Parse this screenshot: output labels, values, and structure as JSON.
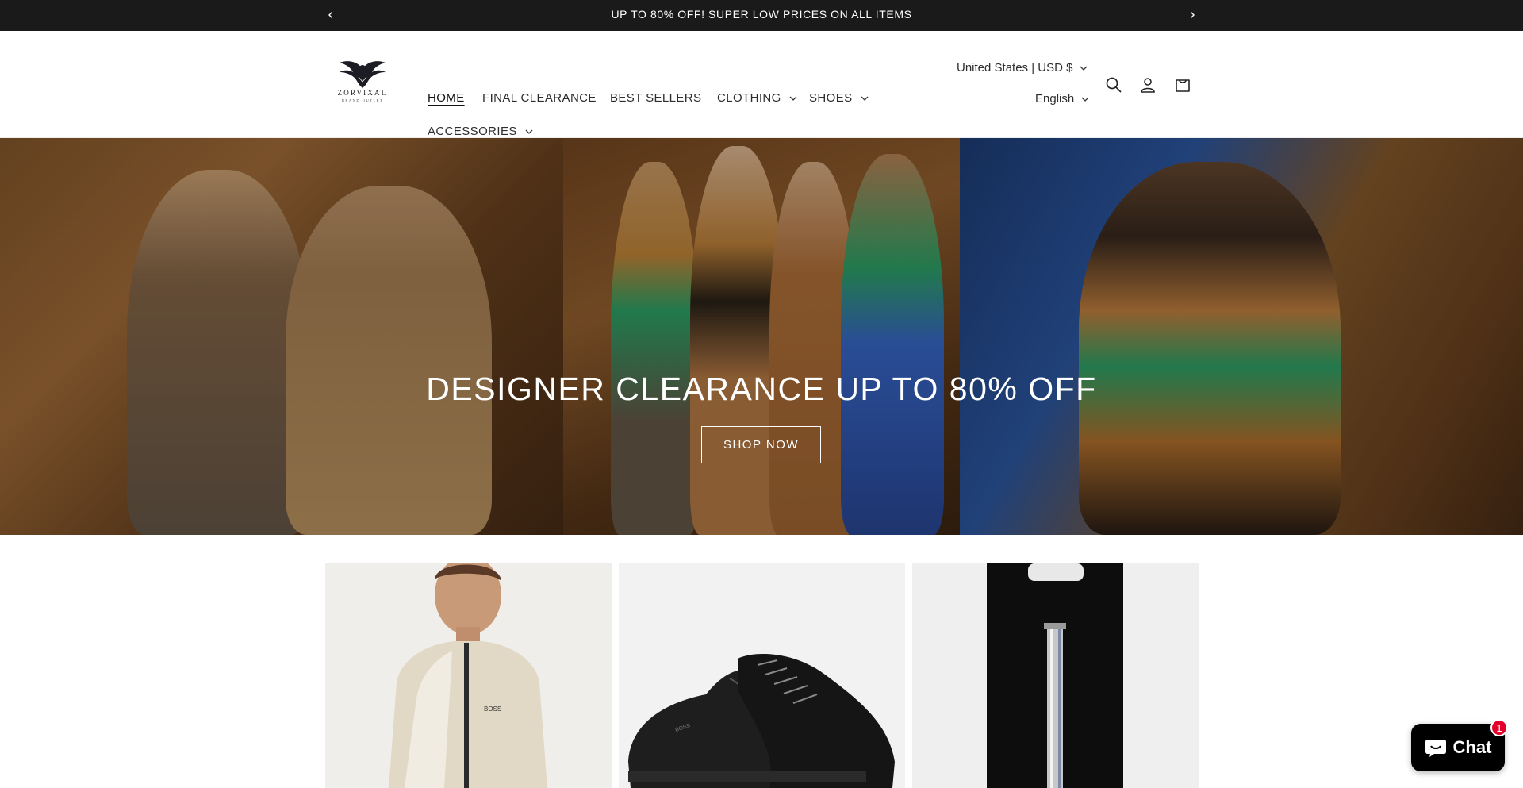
{
  "announcement": {
    "message": "UP TO 80% OFF! SUPER LOW PRICES ON ALL ITEMS"
  },
  "header": {
    "logo": {
      "brand": "ZORVIXAL",
      "sub": "BRAND OUTLET"
    },
    "nav": [
      {
        "label": "HOME",
        "active": true,
        "dropdown": false
      },
      {
        "label": "FINAL CLEARANCE",
        "active": false,
        "dropdown": false
      },
      {
        "label": "BEST SELLERS",
        "active": false,
        "dropdown": false
      },
      {
        "label": "CLOTHING",
        "active": false,
        "dropdown": true
      },
      {
        "label": "SHOES",
        "active": false,
        "dropdown": true
      },
      {
        "label": "ACCESSORIES",
        "active": false,
        "dropdown": true
      }
    ],
    "country_currency": "United States | USD $",
    "language": "English",
    "icons": [
      "search-icon",
      "account-icon",
      "cart-icon"
    ]
  },
  "hero": {
    "title": "DESIGNER CLEARANCE UP TO 80% OFF",
    "cta": "SHOP NOW"
  },
  "products": [
    {
      "image": "beige-zip-jacket-man",
      "brand_mark": "BOSS"
    },
    {
      "image": "black-leather-sneaker",
      "brand_mark": "BOSS"
    },
    {
      "image": "pen-refill-package",
      "brand_mark": ""
    }
  ],
  "chat": {
    "label": "Chat",
    "unread": "1"
  },
  "colors": {
    "announcement_bg": "#1a1a1a",
    "chat_bg": "#000000",
    "badge": "#e3002b"
  }
}
